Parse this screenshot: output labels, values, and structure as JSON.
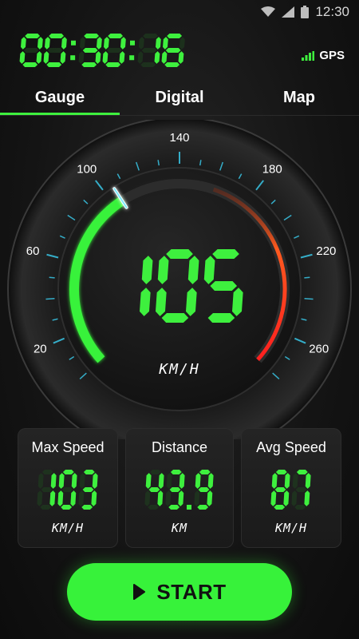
{
  "status_bar": {
    "time": "12:30"
  },
  "timer": {
    "value": "00:30:16"
  },
  "gps": {
    "label": "GPS"
  },
  "tabs": [
    {
      "label": "Gauge",
      "active": true
    },
    {
      "label": "Digital",
      "active": false
    },
    {
      "label": "Map",
      "active": false
    }
  ],
  "gauge": {
    "speed": "105",
    "unit": "KM/H",
    "max": 280,
    "major_labels": [
      "20",
      "60",
      "100",
      "140",
      "180",
      "220",
      "260"
    ],
    "needle_value": 105
  },
  "stats": [
    {
      "label": "Max Speed",
      "value": "103",
      "unit": "KM/H"
    },
    {
      "label": "Distance",
      "value": "43.9",
      "unit": "KM"
    },
    {
      "label": "Avg Speed",
      "value": "87",
      "unit": "KM/H"
    }
  ],
  "start_button": {
    "label": "START"
  },
  "colors": {
    "accent": "#37f23a",
    "digit_on": "#3ef03e",
    "digit_off": "#1e3a1e",
    "gauge_red": "#ff3b1f",
    "tick": "#39c6e6"
  }
}
